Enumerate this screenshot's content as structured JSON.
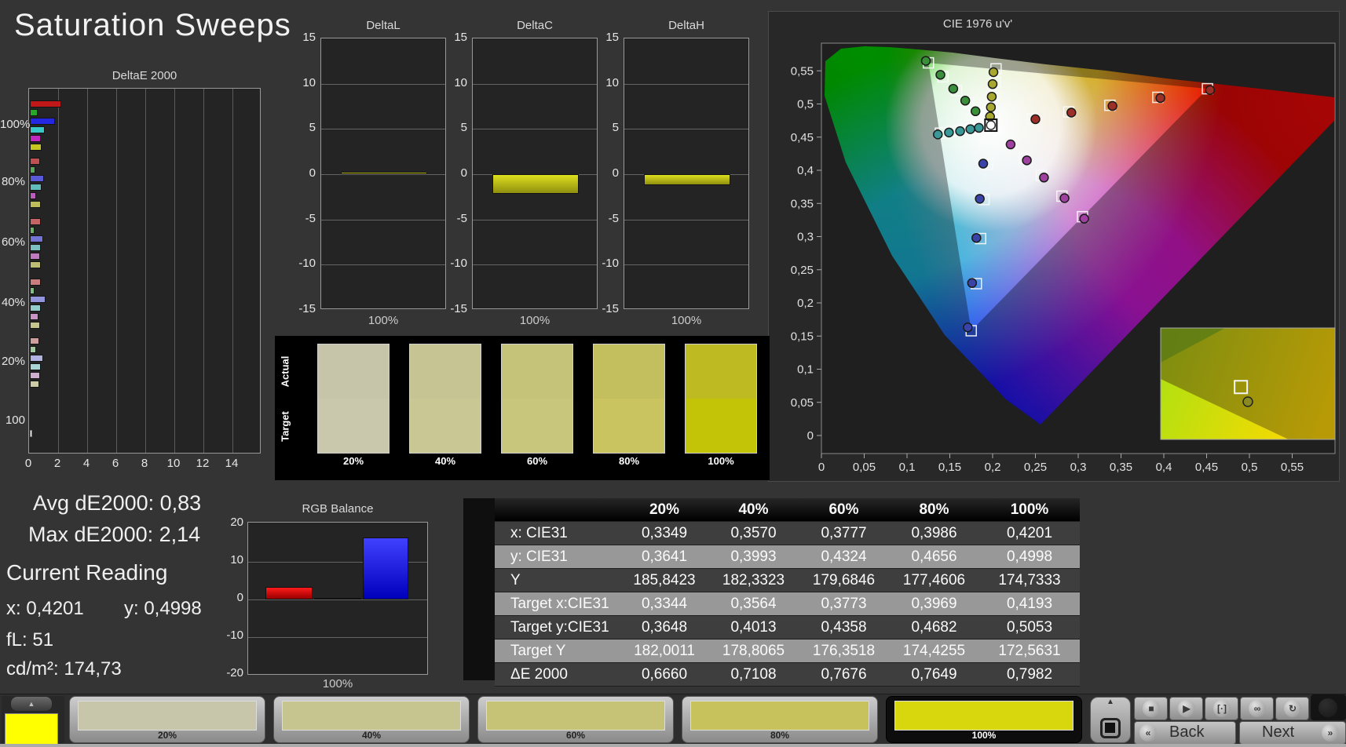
{
  "app": {
    "title": "Saturation Sweeps"
  },
  "chart_data": [
    {
      "type": "bar",
      "orientation": "horizontal",
      "title": "DeltaE 2000",
      "x_ticks": [
        "0",
        "2",
        "4",
        "6",
        "8",
        "10",
        "12",
        "14"
      ],
      "xlim": [
        0,
        16
      ],
      "categories": [
        "100%",
        "80%",
        "60%",
        "40%",
        "20%",
        "100"
      ],
      "bar_order": [
        "red",
        "green",
        "blue",
        "cyan",
        "magenta",
        "yellow"
      ],
      "groups": [
        {
          "label": "100%",
          "values": [
            2.14,
            0.55,
            1.75,
            1.05,
            0.75,
            0.8
          ],
          "colors": [
            "#c01818",
            "#28a828",
            "#2428e0",
            "#38c8c8",
            "#c028c0",
            "#c6c620"
          ]
        },
        {
          "label": "80%",
          "values": [
            0.7,
            0.4,
            0.95,
            0.8,
            0.45,
            0.76
          ],
          "colors": [
            "#c05050",
            "#55aa55",
            "#5a5ad8",
            "#60bcbc",
            "#bc5cbc",
            "#bcbc5c"
          ]
        },
        {
          "label": "60%",
          "values": [
            0.75,
            0.35,
            0.9,
            0.75,
            0.7,
            0.77
          ],
          "colors": [
            "#c46464",
            "#6cb06c",
            "#7474d4",
            "#7cc0c0",
            "#c078c0",
            "#bcbc74"
          ]
        },
        {
          "label": "40%",
          "values": [
            0.75,
            0.3,
            1.1,
            0.75,
            0.6,
            0.71
          ],
          "colors": [
            "#c87e7e",
            "#84bc84",
            "#9494dc",
            "#94cccc",
            "#c894c8",
            "#c4c48c"
          ]
        },
        {
          "label": "20%",
          "values": [
            0.65,
            0.45,
            0.9,
            0.75,
            0.7,
            0.67
          ],
          "colors": [
            "#ce9e9e",
            "#a2c8a2",
            "#b2b2e2",
            "#aad4d4",
            "#ceaece",
            "#cccca6"
          ]
        },
        {
          "label": "100",
          "values": [
            0.15
          ],
          "colors": [
            "#ffffff"
          ]
        }
      ]
    },
    {
      "type": "bar",
      "title": "DeltaL",
      "y_ticks": [
        "15",
        "10",
        "5",
        "0",
        "-5",
        "-10",
        "-15"
      ],
      "ylim": [
        -15,
        15
      ],
      "categories": [
        "100%"
      ],
      "values": [
        0.3
      ],
      "xlabel": "100%",
      "bar_color": "#c8c81e"
    },
    {
      "type": "bar",
      "title": "DeltaC",
      "y_ticks": [
        "15",
        "10",
        "5",
        "0",
        "-5",
        "-10",
        "-15"
      ],
      "ylim": [
        -15,
        15
      ],
      "categories": [
        "100%"
      ],
      "values": [
        -2.2
      ],
      "xlabel": "100%",
      "bar_color": "#c8c81e"
    },
    {
      "type": "bar",
      "title": "DeltaH",
      "y_ticks": [
        "15",
        "10",
        "5",
        "0",
        "-5",
        "-10",
        "-15"
      ],
      "ylim": [
        -15,
        15
      ],
      "categories": [
        "100%"
      ],
      "values": [
        -1.2
      ],
      "xlabel": "100%",
      "bar_color": "#c8c81e"
    },
    {
      "type": "bar",
      "title": "RGB Balance",
      "y_ticks": [
        "20",
        "10",
        "0",
        "-10",
        "-20"
      ],
      "ylim": [
        -20,
        20
      ],
      "categories": [
        "100%"
      ],
      "xlabel": "100%",
      "series": [
        {
          "name": "Red",
          "value": 3.2,
          "color_top": "#ff1a1a",
          "color_bottom": "#990000"
        },
        {
          "name": "Green",
          "value": 0.2,
          "color_top": "#0d0d0d",
          "color_bottom": "#0d0d0d"
        },
        {
          "name": "Blue",
          "value": 16.2,
          "color_top": "#4040ff",
          "color_bottom": "#0000bb"
        }
      ]
    },
    {
      "type": "scatter",
      "title": "CIE 1976 u'v'",
      "x_ticks": [
        "0",
        "0,05",
        "0,1",
        "0,15",
        "0,2",
        "0,25",
        "0,3",
        "0,35",
        "0,4",
        "0,45",
        "0,5",
        "0,55"
      ],
      "y_ticks": [
        "0",
        "0,05",
        "0,1",
        "0,15",
        "0,2",
        "0,25",
        "0,3",
        "0,35",
        "0,4",
        "0,45",
        "0,5",
        "0,55"
      ],
      "xlim": [
        0,
        0.6
      ],
      "ylim": [
        0,
        0.592
      ],
      "white_point": {
        "u": 0.198,
        "v": 0.468
      },
      "sweeps": [
        {
          "name": "red",
          "color": "#9c3028",
          "targets_u": [
            0.246,
            0.289,
            0.337,
            0.393,
            0.451
          ],
          "targets_v": [
            0.478,
            0.488,
            0.498,
            0.51,
            0.523
          ],
          "measured_u": [
            0.25,
            0.292,
            0.34,
            0.396,
            0.454
          ],
          "measured_v": [
            0.477,
            0.487,
            0.497,
            0.509,
            0.521
          ]
        },
        {
          "name": "green",
          "color": "#3a8f3a",
          "targets_u": [
            0.184,
            0.172,
            0.158,
            0.142,
            0.125
          ],
          "targets_v": [
            0.486,
            0.502,
            0.52,
            0.541,
            0.562
          ],
          "measured_u": [
            0.18,
            0.168,
            0.154,
            0.139,
            0.122
          ],
          "measured_v": [
            0.489,
            0.505,
            0.523,
            0.544,
            0.565
          ]
        },
        {
          "name": "blue",
          "color": "#3a44a8",
          "targets_u": [
            0.194,
            0.19,
            0.186,
            0.181,
            0.175
          ],
          "targets_v": [
            0.409,
            0.356,
            0.297,
            0.229,
            0.158
          ],
          "measured_u": [
            0.189,
            0.185,
            0.181,
            0.176,
            0.171
          ],
          "measured_v": [
            0.41,
            0.357,
            0.298,
            0.23,
            0.163
          ]
        },
        {
          "name": "cyan",
          "color": "#3a9898",
          "targets_u": [
            0.187,
            0.177,
            0.165,
            0.152,
            0.139
          ],
          "targets_v": [
            0.466,
            0.464,
            0.461,
            0.459,
            0.456
          ],
          "measured_u": [
            0.184,
            0.174,
            0.162,
            0.149,
            0.136
          ],
          "measured_v": [
            0.464,
            0.462,
            0.459,
            0.457,
            0.454
          ]
        },
        {
          "name": "magenta",
          "color": "#a040a0",
          "targets_u": [
            0.218,
            0.237,
            0.257,
            0.281,
            0.305
          ],
          "targets_v": [
            0.442,
            0.418,
            0.392,
            0.361,
            0.33
          ],
          "measured_u": [
            0.221,
            0.24,
            0.26,
            0.284,
            0.307
          ],
          "measured_v": [
            0.439,
            0.415,
            0.389,
            0.358,
            0.327
          ]
        },
        {
          "name": "yellow",
          "color": "#a8a830",
          "targets_u": [
            0.199,
            0.2,
            0.201,
            0.203,
            0.204
          ],
          "targets_v": [
            0.484,
            0.498,
            0.514,
            0.533,
            0.553
          ],
          "measured_u": [
            0.197,
            0.198,
            0.199,
            0.2,
            0.201
          ],
          "measured_v": [
            0.481,
            0.495,
            0.511,
            0.53,
            0.548
          ]
        }
      ],
      "inset": {
        "target_rel": [
          0.46,
          0.53
        ],
        "measured_rel": [
          0.5,
          0.662
        ]
      }
    }
  ],
  "swatch_panel": {
    "row_labels": [
      "Actual",
      "Target"
    ],
    "items": [
      {
        "label": "20%",
        "actual": "#c6c5aa",
        "target": "#c9c8ac"
      },
      {
        "label": "40%",
        "actual": "#c6c492",
        "target": "#c9c794"
      },
      {
        "label": "60%",
        "actual": "#c5c27a",
        "target": "#c8c67c"
      },
      {
        "label": "80%",
        "actual": "#c4bf5e",
        "target": "#c9c460"
      },
      {
        "label": "100%",
        "actual": "#bdba22",
        "target": "#c3c307"
      }
    ]
  },
  "stats": {
    "avg": "Avg dE2000: 0,83",
    "max": "Max dE2000: 2,14",
    "current_reading": "Current Reading",
    "x": "x: 0,4201",
    "y": "y: 0,4998",
    "fl": "fL: 51",
    "cd": "cd/m²: 174,73"
  },
  "table": {
    "columns": [
      "20%",
      "40%",
      "60%",
      "80%",
      "100%"
    ],
    "rows": [
      {
        "label": "x: CIE31",
        "values": [
          "0,3349",
          "0,3570",
          "0,3777",
          "0,3986",
          "0,4201"
        ]
      },
      {
        "label": "y: CIE31",
        "values": [
          "0,3641",
          "0,3993",
          "0,4324",
          "0,4656",
          "0,4998"
        ]
      },
      {
        "label": "Y",
        "values": [
          "185,8423",
          "182,3323",
          "179,6846",
          "177,4606",
          "174,7333"
        ]
      },
      {
        "label": "Target x:CIE31",
        "values": [
          "0,3344",
          "0,3564",
          "0,3773",
          "0,3969",
          "0,4193"
        ]
      },
      {
        "label": "Target y:CIE31",
        "values": [
          "0,3648",
          "0,4013",
          "0,4358",
          "0,4682",
          "0,5053"
        ]
      },
      {
        "label": "Target Y",
        "values": [
          "182,0011",
          "178,8065",
          "176,3518",
          "174,4255",
          "172,5631"
        ]
      },
      {
        "label": "ΔE 2000",
        "values": [
          "0,6660",
          "0,7108",
          "0,7676",
          "0,7649",
          "0,7982"
        ]
      }
    ]
  },
  "bottom_bar": {
    "up_icon": "▲",
    "corner_color": "#ffff00",
    "swatches": [
      {
        "label": "20%",
        "color": "#c7c6aa",
        "selected": false
      },
      {
        "label": "40%",
        "color": "#c7c58f",
        "selected": false
      },
      {
        "label": "60%",
        "color": "#c6c377",
        "selected": false
      },
      {
        "label": "80%",
        "color": "#c8c25c",
        "selected": false
      },
      {
        "label": "100%",
        "color": "#d8d70e",
        "selected": true
      }
    ]
  },
  "nav": {
    "up_icon": "▲",
    "transport_icons": [
      "■",
      "▶",
      "[·]",
      "∞",
      "↻"
    ],
    "back_icon": "«",
    "next_icon": "»",
    "back_label": "Back",
    "next_label": "Next"
  }
}
